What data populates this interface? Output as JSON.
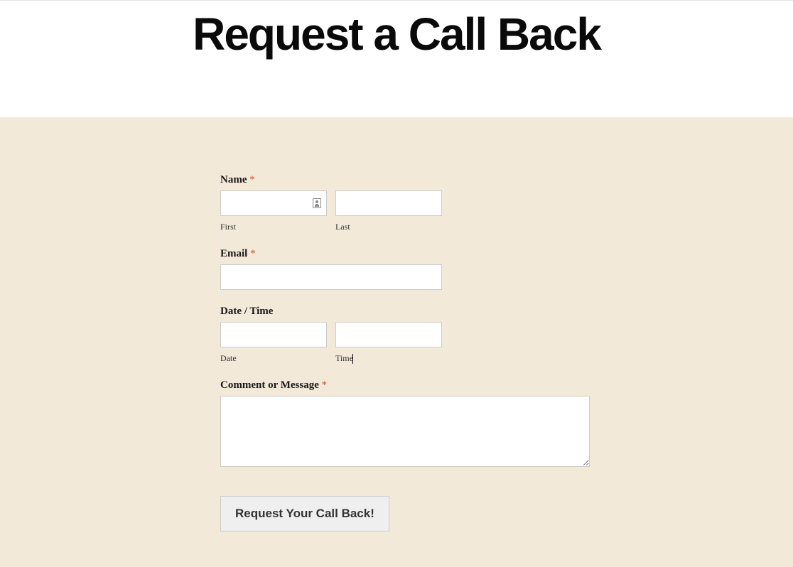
{
  "header": {
    "title": "Request a Call Back"
  },
  "form": {
    "name": {
      "label": "Name",
      "required": "*",
      "first_sublabel": "First",
      "last_sublabel": "Last"
    },
    "email": {
      "label": "Email",
      "required": "*"
    },
    "datetime": {
      "label": "Date / Time",
      "date_sublabel": "Date",
      "time_sublabel": "Time"
    },
    "comment": {
      "label": "Comment or Message",
      "required": "*"
    },
    "submit_label": "Request Your Call Back!"
  }
}
